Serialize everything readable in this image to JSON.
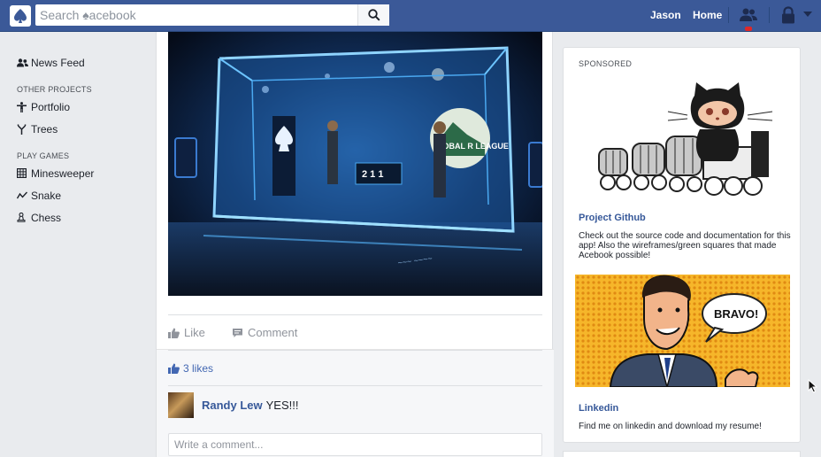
{
  "topbar": {
    "search_placeholder": "Search ♠acebook",
    "user_name": "Jason",
    "home_label": "Home",
    "icons": [
      "spade-logo-icon",
      "search-icon",
      "friends-icon",
      "lock-icon",
      "caret-down-icon"
    ],
    "brand_color": "#3b5998"
  },
  "leftnav": {
    "news_feed": "News Feed",
    "projects_title": "OTHER PROJECTS",
    "projects": [
      "Portfolio",
      "Trees"
    ],
    "games_title": "PLAY GAMES",
    "games": [
      "Minesweeper",
      "Snake",
      "Chess"
    ]
  },
  "post": {
    "photo_scoreboard": "2 1 1",
    "photo_sign": "LOBAL R LEAGUE",
    "like_label": "Like",
    "comment_label": "Comment",
    "likes_count": "3 likes",
    "comment": {
      "author": "Randy Lew",
      "text": "YES!!!"
    },
    "comment_placeholder": "Write a comment..."
  },
  "sidebar": {
    "sponsored_label": "SPONSORED",
    "ads": [
      {
        "title": "Project Github",
        "text": "Check out the source code and documentation for this app! Also the wireframes/green squares that made Acebook possible!"
      },
      {
        "title": "Linkedin",
        "text": "Find me on linkedin and download my resume!",
        "speech_bubble": "BRAVO!"
      }
    ]
  }
}
